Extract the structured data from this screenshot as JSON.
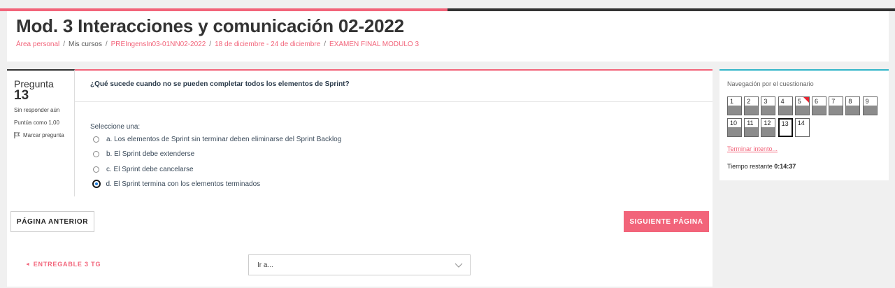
{
  "header": {
    "title": "Mod. 3 Interacciones y comunicación 02-2022",
    "breadcrumb": [
      "Área personal",
      "Mis cursos",
      "PREIngensIn03-01NN02-2022",
      "18 de diciembre - 24 de diciembre",
      "EXAMEN FINAL MODULO 3"
    ]
  },
  "question": {
    "label": "Pregunta",
    "number": "13",
    "status": "Sin responder aún",
    "score": "Puntúa como 1,00",
    "flag_label": "Marcar pregunta",
    "text": "¿Qué sucede cuando no se pueden completar todos los elementos de Sprint?",
    "select_prompt": "Seleccione una:",
    "answers": [
      {
        "label": "a. Los elementos de Sprint sin terminar deben eliminarse del Sprint Backlog",
        "selected": false
      },
      {
        "label": "b. El Sprint debe extenderse",
        "selected": false
      },
      {
        "label": "c. El Sprint debe cancelarse",
        "selected": false
      },
      {
        "label": "d. El Sprint termina con los elementos terminados",
        "selected": true
      }
    ]
  },
  "buttons": {
    "prev_page": "PÁGINA ANTERIOR",
    "next_page": "SIGUIENTE PÁGINA"
  },
  "footer": {
    "prev_activity": "ENTREGABLE 3 TG",
    "prev_arrow": "◄",
    "jump_placeholder": "Ir a..."
  },
  "quiz_nav": {
    "title": "Navegación por el cuestionario",
    "questions": [
      {
        "num": "1",
        "answered": true,
        "flagged": false,
        "current": false
      },
      {
        "num": "2",
        "answered": true,
        "flagged": false,
        "current": false
      },
      {
        "num": "3",
        "answered": true,
        "flagged": false,
        "current": false
      },
      {
        "num": "4",
        "answered": true,
        "flagged": false,
        "current": false
      },
      {
        "num": "5",
        "answered": true,
        "flagged": true,
        "current": false
      },
      {
        "num": "6",
        "answered": true,
        "flagged": false,
        "current": false
      },
      {
        "num": "7",
        "answered": true,
        "flagged": false,
        "current": false
      },
      {
        "num": "8",
        "answered": true,
        "flagged": false,
        "current": false
      },
      {
        "num": "9",
        "answered": true,
        "flagged": false,
        "current": false
      },
      {
        "num": "10",
        "answered": true,
        "flagged": false,
        "current": false
      },
      {
        "num": "11",
        "answered": true,
        "flagged": false,
        "current": false
      },
      {
        "num": "12",
        "answered": true,
        "flagged": false,
        "current": false
      },
      {
        "num": "13",
        "answered": false,
        "flagged": false,
        "current": true
      },
      {
        "num": "14",
        "answered": false,
        "flagged": false,
        "current": false
      }
    ],
    "finish_link": "Terminar intento...",
    "timer_label": "Tiempo restante",
    "timer_value": "0:14:37"
  },
  "colors": {
    "accent": "#f2647a",
    "dark": "#333333",
    "nav_accent": "#33b5c8",
    "answered_fill": "#8c8c8c",
    "flag": "#e8212f"
  }
}
